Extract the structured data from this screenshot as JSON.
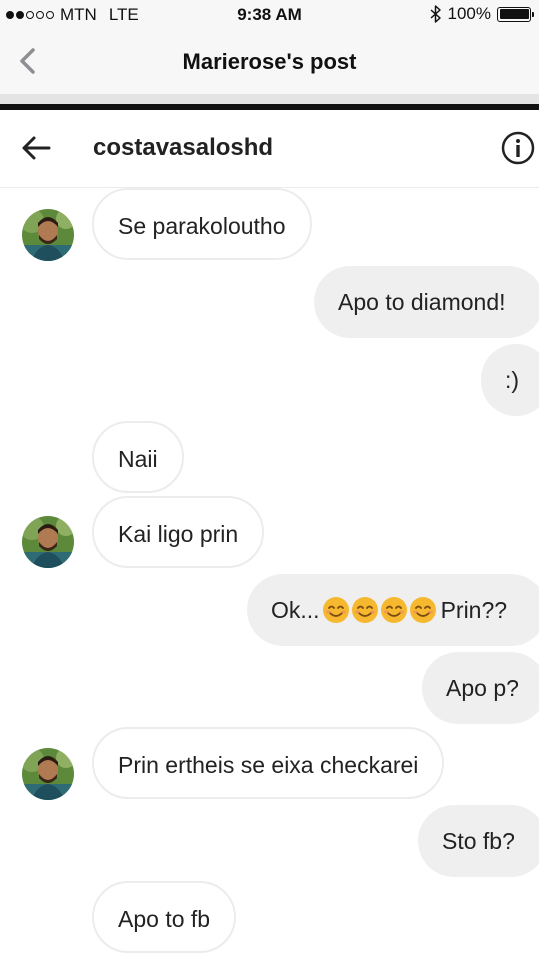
{
  "status_bar": {
    "carrier": "MTN",
    "network": "LTE",
    "time": "9:38 AM",
    "battery": "100%",
    "signal_bars": 2,
    "battery_level": 1.0
  },
  "nav": {
    "title": "Marierose's post",
    "back_icon": "chevron-left-icon"
  },
  "conversation": {
    "username": "costavasaloshd",
    "back_icon": "arrow-left-icon",
    "info_icon": "info-icon"
  },
  "messages": [
    {
      "direction": "in",
      "text": "Se parakoloutho"
    },
    {
      "direction": "out",
      "text": "Apo to diamond!"
    },
    {
      "direction": "out",
      "text": ":)"
    },
    {
      "direction": "in",
      "text": "Naii"
    },
    {
      "direction": "in",
      "text": "Kai ligo prin"
    },
    {
      "direction": "out",
      "text_before": "Ok...",
      "emoji": "smiling-face-emoji",
      "emoji_count": 4,
      "text_after": "Prin??"
    },
    {
      "direction": "out",
      "text": "Apo p?"
    },
    {
      "direction": "in",
      "text": "Prin ertheis se eixa checkarei"
    },
    {
      "direction": "out",
      "text": "Sto fb?"
    },
    {
      "direction": "in",
      "text": "Apo to fb"
    }
  ],
  "colors": {
    "bar_background": "#f7f7f7",
    "incoming_border": "#ececec",
    "outgoing_background": "#efefef",
    "text": "#222222"
  }
}
